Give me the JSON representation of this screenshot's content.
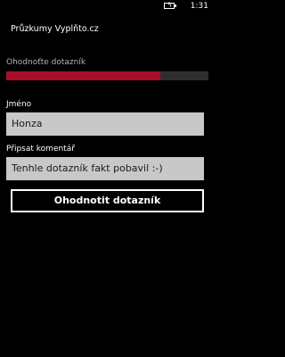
{
  "status_bar": {
    "time": "1:31",
    "battery_icon": "battery-charging-icon"
  },
  "app": {
    "title": "Průzkumy Vyplňto.cz"
  },
  "progress": {
    "label": "Ohodnoťte dotazník",
    "fraction": 0.76,
    "fill_color": "#a80f2b",
    "track_color": "#2e2e2e"
  },
  "form": {
    "name_label": "Jméno",
    "name_value": "Honza",
    "comment_label": "Připsat komentář",
    "comment_value": "Tenhle dotazník fakt pobavil :-)",
    "submit_label": "Ohodnotit dotazník"
  }
}
